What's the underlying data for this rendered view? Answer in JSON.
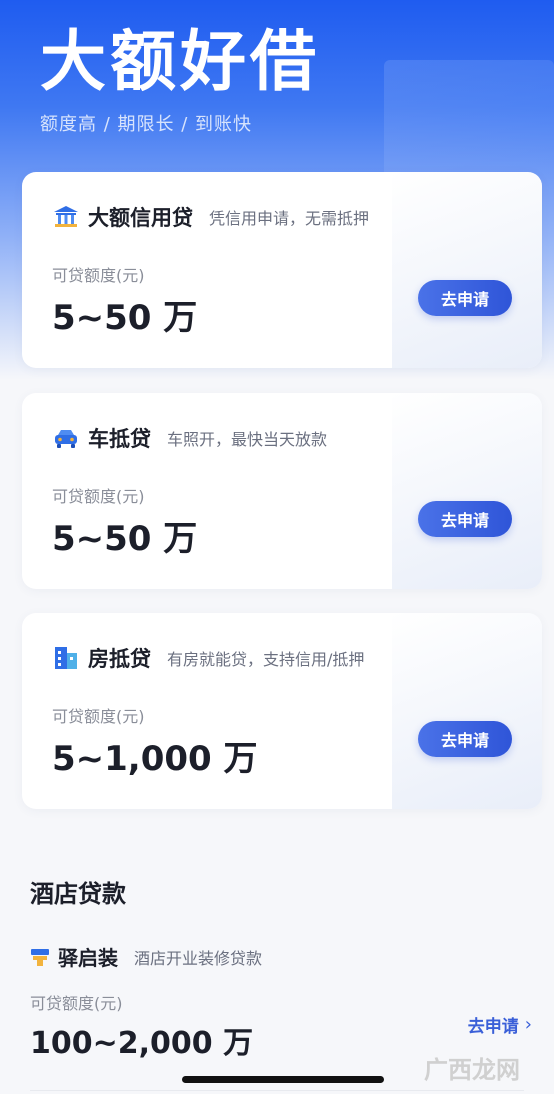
{
  "hero": {
    "title": "大额好借",
    "subtitle": "额度高 / 期限长 / 到账快"
  },
  "cards": [
    {
      "icon": "bank-icon",
      "title": "大额信用贷",
      "desc": "凭信用申请，无需抵押",
      "label": "可贷额度(元)",
      "amount": "5~50 万",
      "button": "去申请"
    },
    {
      "icon": "car-icon",
      "title": "车抵贷",
      "desc": "车照开，最快当天放款",
      "label": "可贷额度(元)",
      "amount": "5~50 万",
      "button": "去申请"
    },
    {
      "icon": "building-icon",
      "title": "房抵贷",
      "desc": "有房就能贷，支持信用/抵押",
      "label": "可贷额度(元)",
      "amount": "5~1,000 万",
      "button": "去申请"
    }
  ],
  "hotel_section": {
    "title": "酒店贷款",
    "item": {
      "icon": "stamp-icon",
      "name": "驿启装",
      "desc": "酒店开业装修贷款",
      "label": "可贷额度(元)",
      "amount": "100~2,000 万",
      "link": "去申请"
    }
  },
  "watermark": "广西龙网",
  "colors": {
    "primary": "#2f55d8",
    "hero_top": "#1f5cf0",
    "text": "#1c1f2a",
    "muted": "#8a8e99"
  }
}
